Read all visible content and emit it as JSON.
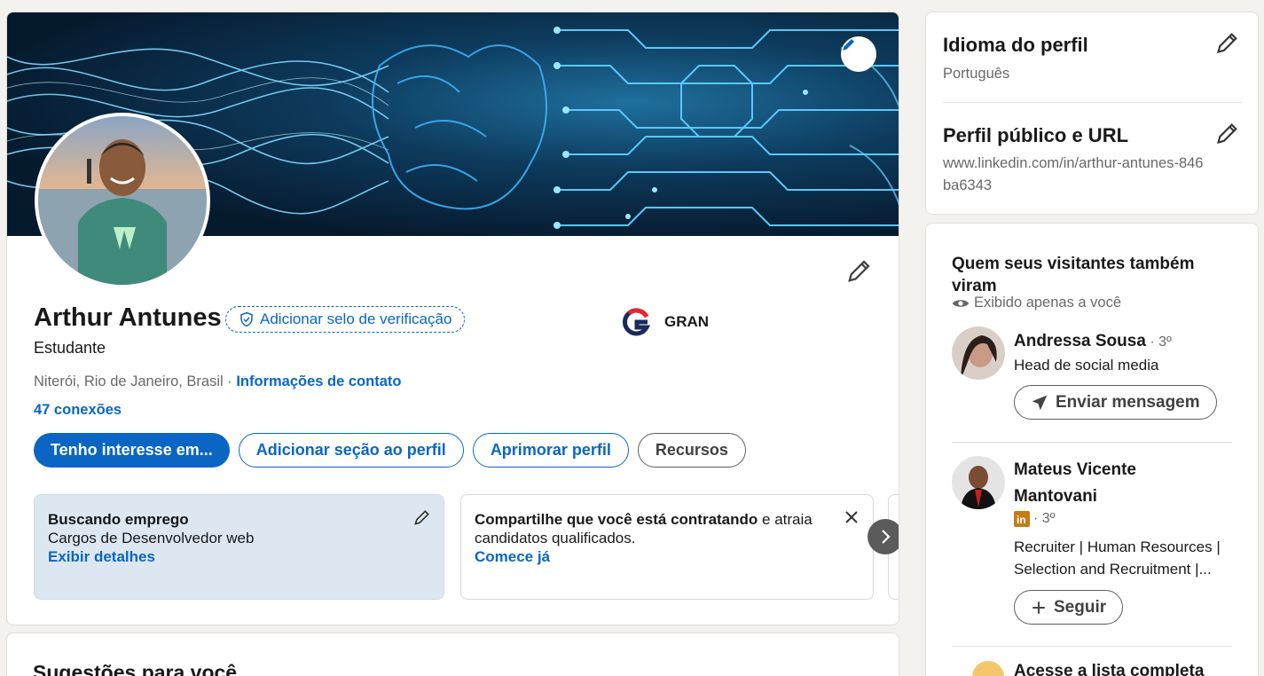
{
  "profile": {
    "name": "Arthur Antunes",
    "verify_badge": "Adicionar selo de verificação",
    "company": "GRAN",
    "headline": "Estudante",
    "location": "Niterói, Rio de Janeiro, Brasil",
    "separator": " · ",
    "contact_info": "Informações de contato",
    "connections": "47 conexões"
  },
  "actions": {
    "open_to": "Tenho interesse em...",
    "add_section": "Adicionar seção ao perfil",
    "enhance": "Aprimorar perfil",
    "resources": "Recursos"
  },
  "open_to_work": {
    "title": "Buscando emprego",
    "detail": "Cargos de Desenvolvedor web",
    "link": "Exibir detalhes"
  },
  "hiring": {
    "title_bold": "Compartilhe que você está contratando",
    "title_rest": " e atraia candidatos qualificados.",
    "link": "Comece já"
  },
  "suggestions": {
    "title": "Sugestões para você"
  },
  "right": {
    "lang_title": "Idioma do perfil",
    "lang_value": "Português",
    "url_title": "Perfil público e URL",
    "url_value": "www.linkedin.com/in/arthur-antunes-846ba6343",
    "visitors_title": "Quem seus visitantes também viram",
    "visitors_sub": "Exibido apenas a você",
    "people": [
      {
        "name": "Andressa Sousa",
        "degree": " · 3º",
        "headline": "Head de social media",
        "action": "Enviar mensagem"
      },
      {
        "name": "Mateus Vicente Mantovani",
        "degree": "· 3º",
        "headline": "Recruiter | Human Resources | Selection and Recruitment |...",
        "action": "Seguir"
      }
    ],
    "full_list": "Acesse a lista completa"
  },
  "colors": {
    "accent": "#0a66c2",
    "background": "#f4f2ee"
  },
  "icons": [
    "pencil-icon",
    "shield-check-icon",
    "eye-icon",
    "send-icon",
    "plus-icon",
    "close-icon",
    "chevron-right-icon",
    "linkedin-premium-icon"
  ]
}
